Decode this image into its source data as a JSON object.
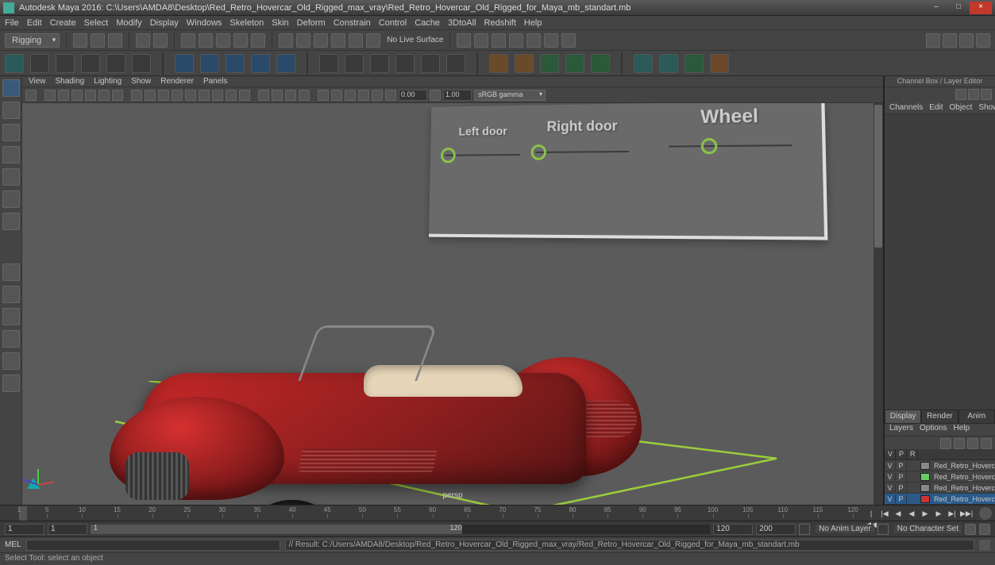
{
  "titlebar": {
    "text": "Autodesk Maya 2016: C:\\Users\\AMDA8\\Desktop\\Red_Retro_Hovercar_Old_Rigged_max_vray\\Red_Retro_Hovercar_Old_Rigged_for_Maya_mb_standart.mb"
  },
  "mainmenu": [
    "File",
    "Edit",
    "Create",
    "Select",
    "Modify",
    "Display",
    "Windows",
    "Skeleton",
    "Skin",
    "Deform",
    "Constrain",
    "Control",
    "Cache",
    "3DtoAll",
    "Redshift",
    "Help"
  ],
  "statusline": {
    "mode": "Rigging",
    "nolive": "No Live Surface"
  },
  "panelmenu": [
    "View",
    "Shading",
    "Lighting",
    "Show",
    "Renderer",
    "Panels"
  ],
  "paneltoolbar": {
    "num1": "0.00",
    "num2": "1.00",
    "colorspace": "sRGB gamma"
  },
  "viewport": {
    "persp": "persp",
    "controls": {
      "left": "Left door",
      "right": "Right door",
      "wheel": "Wheel"
    }
  },
  "channelbox": {
    "title": "Channel Box / Layer Editor",
    "menu": [
      "Channels",
      "Edit",
      "Object",
      "Show"
    ],
    "tabs": [
      "Display",
      "Render",
      "Anim"
    ],
    "submenu": [
      "Layers",
      "Options",
      "Help"
    ],
    "head": {
      "v": "V",
      "p": "P",
      "r": "R"
    },
    "layers": [
      {
        "v": "V",
        "p": "P",
        "e": "",
        "color": "#888888",
        "name": "Red_Retro_Hovercar_Old_...",
        "selected": false
      },
      {
        "v": "V",
        "p": "P",
        "e": "",
        "color": "#66cc66",
        "name": "Red_Retro_Hovercar_C...",
        "selected": false
      },
      {
        "v": "V",
        "p": "P",
        "e": "",
        "color": "#888888",
        "name": "Red_Retro_Hovercar_C...",
        "selected": false
      },
      {
        "v": "V",
        "p": "P",
        "e": "",
        "color": "#cc3333",
        "name": "Red_Retro_Hovercar_C...",
        "selected": true
      }
    ]
  },
  "timeline": {
    "ticks": [
      1,
      5,
      10,
      15,
      20,
      25,
      30,
      35,
      40,
      45,
      50,
      55,
      60,
      65,
      70,
      75,
      80,
      85,
      90,
      95,
      100,
      105,
      110,
      115,
      120
    ]
  },
  "range": {
    "start_outer": "1",
    "start_inner": "1",
    "cur": "1",
    "end_inner": "120",
    "end_outer": "120",
    "total": "200",
    "animlayer": "No Anim Layer",
    "charset": "No Character Set"
  },
  "cmd": {
    "lang": "MEL",
    "result": "// Result: C:/Users/AMDA8/Desktop/Red_Retro_Hovercar_Old_Rigged_max_vray/Red_Retro_Hovercar_Old_Rigged_for_Maya_mb_standart.mb"
  },
  "help": "Select Tool: select an object"
}
